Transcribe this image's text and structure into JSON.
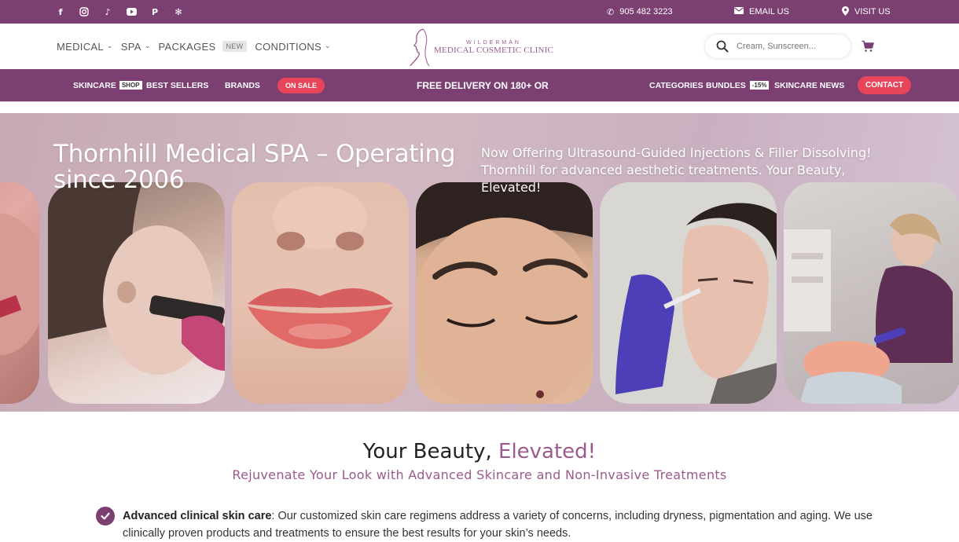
{
  "colors": {
    "brand": "#7b3f72",
    "accent": "#9b5a8c",
    "sale": "#e8455a"
  },
  "topbar": {
    "social_icons": [
      "facebook-icon",
      "instagram-icon",
      "tiktok-icon",
      "youtube-icon",
      "pinterest-icon",
      "yelp-icon"
    ],
    "phone": "905 482 3223",
    "email_label": "EMAIL US",
    "visit_label": "VISIT US"
  },
  "nav": {
    "medical": "MEDICAL",
    "spa": "SPA",
    "packages": "PACKAGES",
    "new_badge": "NEW",
    "conditions": "CONDITIONS"
  },
  "logo": {
    "line1": "WILDERMAN",
    "line2": "MEDICAL COSMETIC CLINIC"
  },
  "search": {
    "placeholder": "Cream, Sunscreen..."
  },
  "subnav": {
    "skincare": "SKINCARE",
    "shop_badge": "SHOP",
    "best_sellers": "BEST SELLERS",
    "brands": "BRANDS",
    "on_sale": "ON SALE",
    "free_delivery": "FREE DELIVERY ON 180+ OR",
    "categories": "CATEGORIES",
    "bundles": "BUNDLES",
    "bundles_badge": "-15%",
    "skincare_news": "SKINCARE NEWS",
    "contact": "CONTACT"
  },
  "hero": {
    "title": "Thornhill Medical SPA – Operating since 2006",
    "description": "Now Offering Ultrasound-Guided Injections & Filler Dissolving! Thornhill for advanced aesthetic treatments. Your Beauty, Elevated!"
  },
  "intro": {
    "title_main": "Your Beauty, ",
    "title_accent": "Elevated!",
    "subtitle": "Rejuvenate Your Look with Advanced Skincare and Non-Invasive Treatments"
  },
  "features": [
    {
      "title": "Advanced clinical skin care",
      "text": ": Our customized skin care regimens address a variety of concerns, including dryness, pigmentation and aging. We use clinically proven products and treatments to ensure the best results for your skin’s needs."
    }
  ]
}
